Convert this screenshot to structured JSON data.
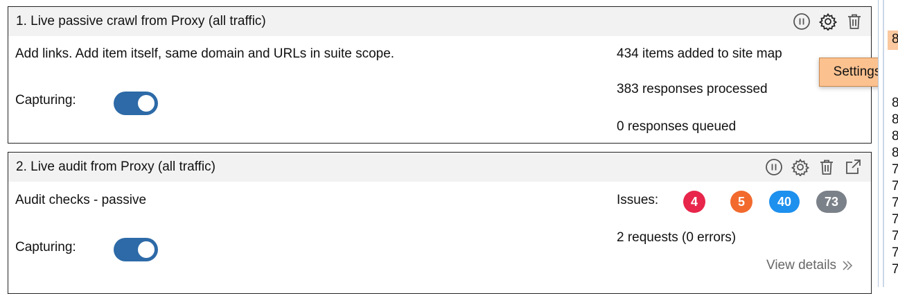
{
  "tasks": [
    {
      "title": "1. Live passive crawl from Proxy (all traffic)",
      "description": "Add links. Add item itself, same domain and URLs in suite scope.",
      "capturing_label": "Capturing:",
      "capturing_on": true,
      "stats": [
        "434 items added to site map",
        "383 responses processed",
        "0 responses queued"
      ],
      "icons": [
        "pause-icon",
        "gear-icon",
        "trash-icon"
      ]
    },
    {
      "title": "2. Live audit from Proxy (all traffic)",
      "description": "Audit checks - passive",
      "capturing_label": "Capturing:",
      "capturing_on": true,
      "issues_label": "Issues:",
      "issues": [
        {
          "count": "4",
          "color": "#e8254a"
        },
        {
          "count": "5",
          "color": "#f26a2e"
        },
        {
          "count": "40",
          "color": "#1e90ee"
        },
        {
          "count": "73",
          "color": "#7b8189"
        }
      ],
      "requests": "2 requests (0 errors)",
      "view_details": "View details",
      "icons": [
        "pause-icon",
        "gear-icon",
        "trash-icon",
        "popout-icon"
      ]
    }
  ],
  "tooltip": "Settings",
  "right_panel_digits": [
    "8",
    "8",
    "8",
    "8",
    "7",
    "7",
    "7",
    "7",
    "7",
    "7",
    "7"
  ]
}
